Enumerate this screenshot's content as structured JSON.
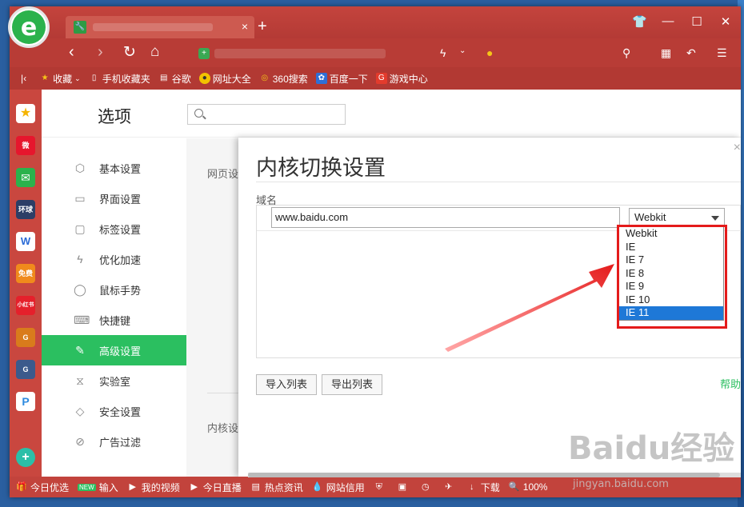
{
  "browser": {
    "logo_letter": "e",
    "tab_close": "×",
    "new_tab": "+",
    "window_buttons": [
      "👕",
      "—",
      "☐",
      "✕"
    ],
    "nav": {
      "back": "‹",
      "forward": "›",
      "refresh": "↻",
      "home": "⌂"
    },
    "bookmarks": [
      {
        "label": "收藏",
        "icon": "star-icon",
        "color": "#f5c518"
      },
      {
        "label": "手机收藏夹",
        "icon": "phone-icon",
        "color": "#ffffff"
      },
      {
        "label": "谷歌",
        "icon": "page-icon",
        "color": "#ffffff"
      },
      {
        "label": "网址大全",
        "icon": "globe-icon",
        "color": "#f2c200"
      },
      {
        "label": "360搜索",
        "icon": "search360-icon",
        "color": "#3aa853"
      },
      {
        "label": "百度一下",
        "icon": "baidu-paw-icon",
        "color": "#2f6fd6"
      },
      {
        "label": "游戏中心",
        "icon": "game-icon",
        "color": "#e33b2c"
      }
    ],
    "sidebar_apps": [
      {
        "name": "favorites-app-icon",
        "label": "★",
        "color": "#f5b400"
      },
      {
        "name": "weibo-app-icon",
        "label": "微",
        "color": "#e6162d"
      },
      {
        "name": "mail-app-icon",
        "label": "✉",
        "color": "#2bb24c"
      },
      {
        "name": "news-app-icon",
        "label": "环球",
        "color": "#2c3e66"
      },
      {
        "name": "word-app-icon",
        "label": "W",
        "color": "#2b6bd6"
      },
      {
        "name": "novel-app-icon",
        "label": "免费",
        "color": "#f08a1c"
      },
      {
        "name": "xiaohongshu-app-icon",
        "label": "小红书",
        "color": "#e5202b"
      },
      {
        "name": "game1-app-icon",
        "label": "G",
        "color": "#d97b1c"
      },
      {
        "name": "game2-app-icon",
        "label": "G",
        "color": "#3b5a8c"
      },
      {
        "name": "pp-app-icon",
        "label": "P",
        "color": "#2f8be0"
      },
      {
        "name": "add-app-icon",
        "label": "+",
        "color": "#2bbfa8"
      }
    ]
  },
  "options": {
    "title": "选项",
    "nav": [
      {
        "label": "基本设置",
        "icon": "⬡"
      },
      {
        "label": "界面设置",
        "icon": "▭"
      },
      {
        "label": "标签设置",
        "icon": "▢"
      },
      {
        "label": "优化加速",
        "icon": "ϟ"
      },
      {
        "label": "鼠标手势",
        "icon": "◯"
      },
      {
        "label": "快捷键",
        "icon": "⌨"
      },
      {
        "label": "高级设置",
        "icon": "✎"
      },
      {
        "label": "实验室",
        "icon": "⧖"
      },
      {
        "label": "安全设置",
        "icon": "◇"
      },
      {
        "label": "广告过滤",
        "icon": "⊘"
      }
    ],
    "active_index": 6,
    "content_sections": [
      "网页设",
      "内核设"
    ]
  },
  "dialog": {
    "title": "内核切换设置",
    "close": "×",
    "column_label": "域名",
    "domain_value": "www.baidu.com",
    "engine_selected": "Webkit",
    "engine_options": [
      "Webkit",
      "IE",
      "IE 7",
      "IE 8",
      "IE 9",
      "IE 10",
      "IE 11"
    ],
    "highlighted_option": "IE 11",
    "import_label": "导入列表",
    "export_label": "导出列表",
    "help_label": "帮助"
  },
  "statusbar": [
    {
      "label": "今日优选",
      "icon": "🎁"
    },
    {
      "label": "输入",
      "icon": "",
      "badge": "NEW"
    },
    {
      "label": "我的视频",
      "icon": "▶"
    },
    {
      "label": "今日直播",
      "icon": "▶"
    },
    {
      "label": "热点资讯",
      "icon": "▤"
    },
    {
      "label": "网站信用",
      "icon": "💧"
    },
    {
      "label": "",
      "icon": "⛨"
    },
    {
      "label": "",
      "icon": "▣"
    },
    {
      "label": "",
      "icon": "◷"
    },
    {
      "label": "",
      "icon": "✈"
    },
    {
      "label": "下载",
      "icon": "↓"
    },
    {
      "label": "100%",
      "icon": "🔍"
    }
  ],
  "watermark": {
    "text": "Baidu经验",
    "sub": "jingyan.baidu.com"
  }
}
